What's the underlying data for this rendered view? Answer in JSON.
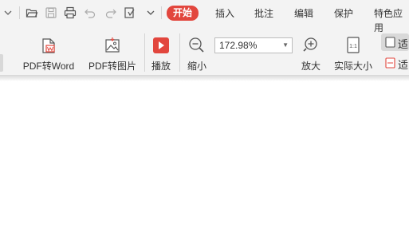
{
  "quick_access": {
    "icons": [
      "chevron-down-icon",
      "folder-open-icon",
      "save-icon",
      "print-icon",
      "undo-icon",
      "redo-icon",
      "export-icon",
      "dropdown-icon"
    ]
  },
  "menu": {
    "items": [
      {
        "label": "开始",
        "active": true
      },
      {
        "label": "插入",
        "active": false
      },
      {
        "label": "批注",
        "active": false
      },
      {
        "label": "编辑",
        "active": false
      },
      {
        "label": "保护",
        "active": false
      },
      {
        "label": "特色应用",
        "active": false
      }
    ]
  },
  "toolbar": {
    "pdf_to_word": "PDF转Word",
    "pdf_to_image": "PDF转图片",
    "play": "播放",
    "zoom_out": "缩小",
    "zoom_value": "172.98%",
    "zoom_in": "放大",
    "actual_size": "实际大小",
    "fit_1": "适",
    "fit_2": "适",
    "actual_size_icon_text": "1:1"
  },
  "colors": {
    "accent": "#e2463d",
    "toolbar_bg": "#f3f3f3",
    "page_bg": "#ffffff"
  }
}
